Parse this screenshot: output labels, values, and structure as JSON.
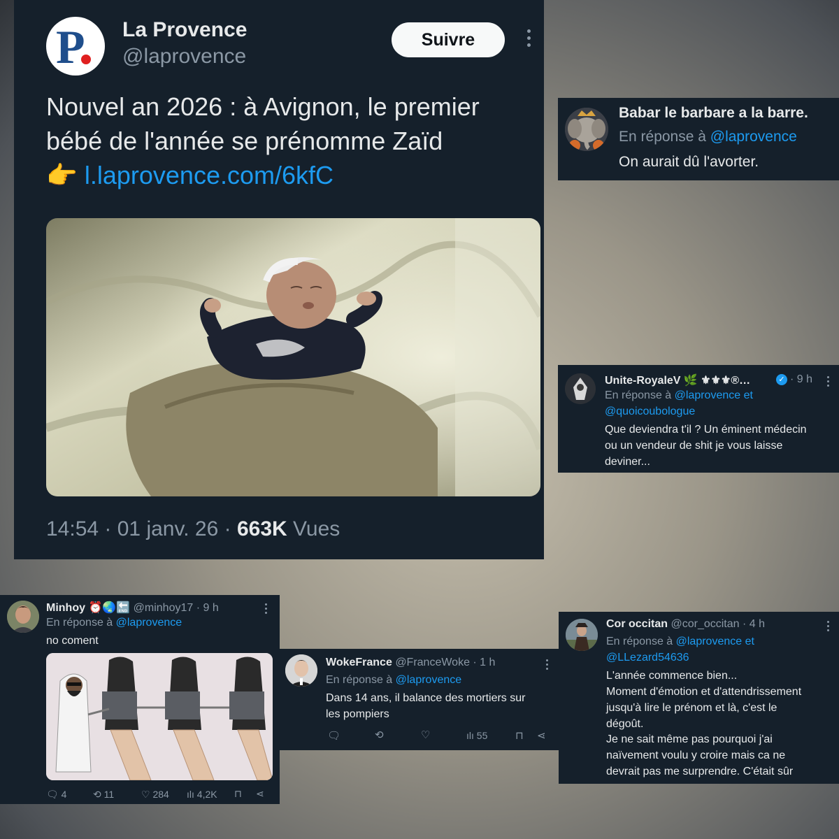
{
  "main_tweet": {
    "name": "La Provence",
    "handle": "@laprovence",
    "follow_label": "Suivre",
    "text_line1": "Nouvel an 2026 : à Avignon, le premier",
    "text_line2": "bébé de l'année se prénomme Zaïd",
    "link_emoji": "👉",
    "link": "l.laprovence.com/6kfC",
    "time": "14:54 · 01 janv. 26 · ",
    "views": "663K",
    "views_label": " Vues"
  },
  "reply_babar": {
    "name": "Babar le barbare a la barre.",
    "in_reply": "En réponse à ",
    "mention": "@laprovence",
    "text": "On aurait dû l'avorter."
  },
  "reply_unite": {
    "name": "Unite-RoyaleV 🌿 ⚜⚜⚜®…",
    "time": "· 9 h",
    "in_reply": "En réponse à ",
    "mention1": "@laprovence et",
    "mention2": "@quoicoubologue",
    "text_lines": [
      "Que deviendra t'il ? Un éminent médecin",
      "ou un vendeur de shit je vous laisse",
      "deviner..."
    ]
  },
  "reply_minhoy": {
    "name": "Minhoy ⏰🌏🔚",
    "handle": "@minhoy17 · 9 h",
    "in_reply": "En réponse à ",
    "mention": "@laprovence",
    "text": "no coment",
    "actions": {
      "replies": "4",
      "retweets": "11",
      "likes": "284",
      "views": "4,2K"
    }
  },
  "reply_woke": {
    "name": "WokeFrance",
    "handle": "@FranceWoke · 1 h",
    "in_reply": "En réponse à ",
    "mention": "@laprovence",
    "text_lines": [
      "Dans 14 ans, il balance des mortiers sur",
      "les pompiers"
    ],
    "actions": {
      "views": "55"
    }
  },
  "reply_cor": {
    "name": "Cor occitan",
    "handle": "@cor_occitan · 4 h",
    "in_reply": "En réponse à ",
    "mention1": "@laprovence et",
    "mention2": "@LLezard54636",
    "text_lines": [
      "L'année commence bien...",
      "Moment d'émotion et d'attendrissement",
      "jusqu'à lire le prénom et là, c'est le",
      "dégoût.",
      "Je ne sait même pas pourquoi j'ai",
      "naïvement voulu y croire mais ca ne",
      "devrait pas me surprendre. C'était sûr"
    ]
  },
  "colors": {
    "card_bg": "#15202b",
    "link": "#1d9bf0",
    "muted": "#8b98a5",
    "text": "#e7e9ea",
    "verified": "#1d9bf0"
  }
}
